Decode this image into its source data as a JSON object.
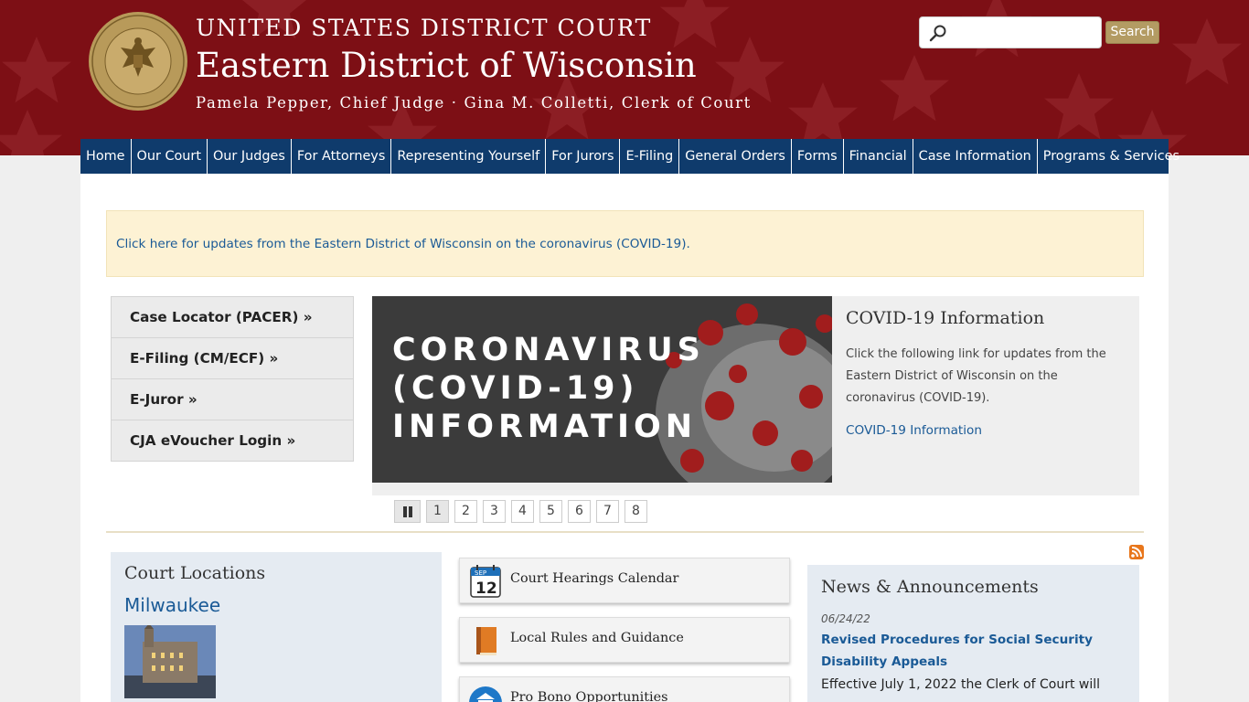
{
  "header": {
    "supertitle": "UNITED STATES DISTRICT COURT",
    "title": "Eastern District of Wisconsin",
    "subtitle": "Pamela Pepper, Chief Judge · Gina M. Colletti, Clerk of Court",
    "search_placeholder": "",
    "search_button": "Search"
  },
  "nav": [
    "Home",
    "Our Court",
    "Our Judges",
    "For Attorneys",
    "Representing Yourself",
    "For Jurors",
    "E-Filing",
    "General Orders",
    "Forms",
    "Financial",
    "Case Information",
    "Programs & Services"
  ],
  "alert": {
    "text": "Click here for updates from the Eastern District of Wisconsin on the coronavirus (COVID-19)."
  },
  "quick_links": [
    "Case Locator (PACER) »",
    "E-Filing (CM/ECF) »",
    "E-Juror »",
    "CJA eVoucher Login »"
  ],
  "slideshow": {
    "image_text": [
      "CORONAVIRUS",
      "(COVID-19)",
      "INFORMATION"
    ],
    "caption_title": "COVID-19 Information",
    "caption_text": "Click the following link for updates from the Eastern District of Wisconsin on the coronavirus (COVID-19).",
    "caption_link": "COVID-19 Information",
    "pages": [
      "1",
      "2",
      "3",
      "4",
      "5",
      "6",
      "7",
      "8"
    ],
    "active_page": "1"
  },
  "locations": {
    "title": "Court Locations",
    "city": "Milwaukee"
  },
  "features": [
    {
      "label": "Court Hearings Calendar",
      "icon": "calendar-icon",
      "calendar_month": "SEP",
      "calendar_day": "12"
    },
    {
      "label": "Local Rules and Guidance",
      "icon": "book-icon"
    },
    {
      "label": "Pro Bono Opportunities",
      "icon": "courthouse-icon"
    }
  ],
  "news": {
    "title": "News & Announcements",
    "date": "06/24/22",
    "headline": "Revised Procedures for Social Security Disability Appeals",
    "body": "Effective July 1, 2022 the Clerk of Court will"
  },
  "colors": {
    "header": "#7d0f15",
    "nav": "#0f3b6c",
    "link": "#1a5a96",
    "search_button": "#b39b63"
  }
}
